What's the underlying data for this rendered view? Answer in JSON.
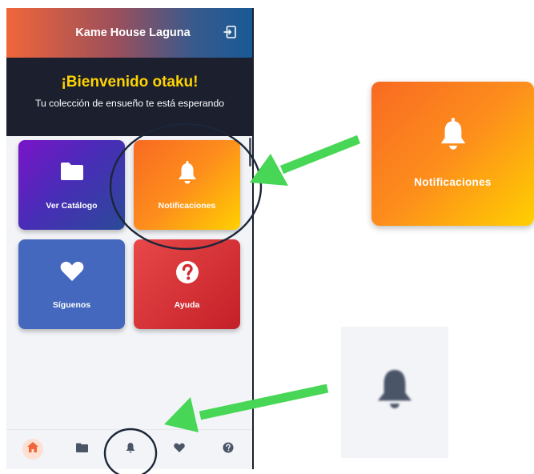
{
  "app": {
    "title": "Kame House Laguna"
  },
  "welcome": {
    "title": "¡Bienvenido otaku!",
    "subtitle": "Tu colección de ensueño te está esperando"
  },
  "tiles": [
    {
      "label": "Ver Catálogo",
      "icon": "folder-icon"
    },
    {
      "label": "Notificaciones",
      "icon": "bell-icon"
    },
    {
      "label": "Síguenos",
      "icon": "heart-icon"
    },
    {
      "label": "Ayuda",
      "icon": "question-icon"
    }
  ],
  "bottom_nav": {
    "items": [
      {
        "icon": "home-icon",
        "active": true
      },
      {
        "icon": "folder-icon",
        "active": false
      },
      {
        "icon": "bell-icon",
        "active": false
      },
      {
        "icon": "heart-icon",
        "active": false
      },
      {
        "icon": "question-icon",
        "active": false
      }
    ]
  },
  "callouts": {
    "zoom_tile_label": "Notificaciones",
    "zoom_bell_icon": "bell-icon"
  },
  "colors": {
    "accent": "#f0663a",
    "header_dark": "#1b1f2e",
    "welcome_title": "#ffd300",
    "nav_icon": "#4b5568",
    "annotation_arrow": "#48d656",
    "annotation_circle": "#1b2638"
  }
}
